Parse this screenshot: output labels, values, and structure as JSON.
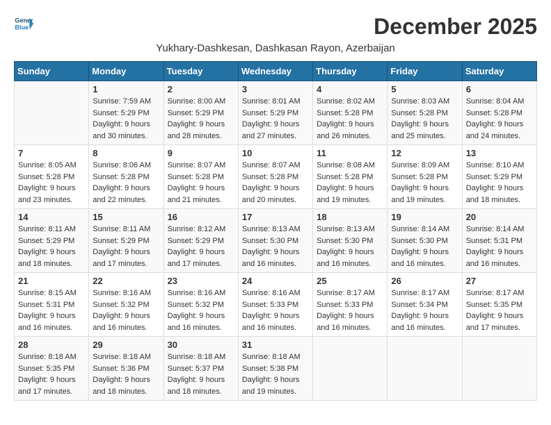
{
  "header": {
    "logo_general": "General",
    "logo_blue": "Blue",
    "month_year": "December 2025",
    "location": "Yukhary-Dashkesan, Dashkasan Rayon, Azerbaijan"
  },
  "days_of_week": [
    "Sunday",
    "Monday",
    "Tuesday",
    "Wednesday",
    "Thursday",
    "Friday",
    "Saturday"
  ],
  "weeks": [
    [
      {
        "day": "",
        "info": ""
      },
      {
        "day": "1",
        "info": "Sunrise: 7:59 AM\nSunset: 5:29 PM\nDaylight: 9 hours and 30 minutes."
      },
      {
        "day": "2",
        "info": "Sunrise: 8:00 AM\nSunset: 5:29 PM\nDaylight: 9 hours and 28 minutes."
      },
      {
        "day": "3",
        "info": "Sunrise: 8:01 AM\nSunset: 5:29 PM\nDaylight: 9 hours and 27 minutes."
      },
      {
        "day": "4",
        "info": "Sunrise: 8:02 AM\nSunset: 5:28 PM\nDaylight: 9 hours and 26 minutes."
      },
      {
        "day": "5",
        "info": "Sunrise: 8:03 AM\nSunset: 5:28 PM\nDaylight: 9 hours and 25 minutes."
      },
      {
        "day": "6",
        "info": "Sunrise: 8:04 AM\nSunset: 5:28 PM\nDaylight: 9 hours and 24 minutes."
      }
    ],
    [
      {
        "day": "7",
        "info": "Sunrise: 8:05 AM\nSunset: 5:28 PM\nDaylight: 9 hours and 23 minutes."
      },
      {
        "day": "8",
        "info": "Sunrise: 8:06 AM\nSunset: 5:28 PM\nDaylight: 9 hours and 22 minutes."
      },
      {
        "day": "9",
        "info": "Sunrise: 8:07 AM\nSunset: 5:28 PM\nDaylight: 9 hours and 21 minutes."
      },
      {
        "day": "10",
        "info": "Sunrise: 8:07 AM\nSunset: 5:28 PM\nDaylight: 9 hours and 20 minutes."
      },
      {
        "day": "11",
        "info": "Sunrise: 8:08 AM\nSunset: 5:28 PM\nDaylight: 9 hours and 19 minutes."
      },
      {
        "day": "12",
        "info": "Sunrise: 8:09 AM\nSunset: 5:28 PM\nDaylight: 9 hours and 19 minutes."
      },
      {
        "day": "13",
        "info": "Sunrise: 8:10 AM\nSunset: 5:29 PM\nDaylight: 9 hours and 18 minutes."
      }
    ],
    [
      {
        "day": "14",
        "info": "Sunrise: 8:11 AM\nSunset: 5:29 PM\nDaylight: 9 hours and 18 minutes."
      },
      {
        "day": "15",
        "info": "Sunrise: 8:11 AM\nSunset: 5:29 PM\nDaylight: 9 hours and 17 minutes."
      },
      {
        "day": "16",
        "info": "Sunrise: 8:12 AM\nSunset: 5:29 PM\nDaylight: 9 hours and 17 minutes."
      },
      {
        "day": "17",
        "info": "Sunrise: 8:13 AM\nSunset: 5:30 PM\nDaylight: 9 hours and 16 minutes."
      },
      {
        "day": "18",
        "info": "Sunrise: 8:13 AM\nSunset: 5:30 PM\nDaylight: 9 hours and 16 minutes."
      },
      {
        "day": "19",
        "info": "Sunrise: 8:14 AM\nSunset: 5:30 PM\nDaylight: 9 hours and 16 minutes."
      },
      {
        "day": "20",
        "info": "Sunrise: 8:14 AM\nSunset: 5:31 PM\nDaylight: 9 hours and 16 minutes."
      }
    ],
    [
      {
        "day": "21",
        "info": "Sunrise: 8:15 AM\nSunset: 5:31 PM\nDaylight: 9 hours and 16 minutes."
      },
      {
        "day": "22",
        "info": "Sunrise: 8:16 AM\nSunset: 5:32 PM\nDaylight: 9 hours and 16 minutes."
      },
      {
        "day": "23",
        "info": "Sunrise: 8:16 AM\nSunset: 5:32 PM\nDaylight: 9 hours and 16 minutes."
      },
      {
        "day": "24",
        "info": "Sunrise: 8:16 AM\nSunset: 5:33 PM\nDaylight: 9 hours and 16 minutes."
      },
      {
        "day": "25",
        "info": "Sunrise: 8:17 AM\nSunset: 5:33 PM\nDaylight: 9 hours and 16 minutes."
      },
      {
        "day": "26",
        "info": "Sunrise: 8:17 AM\nSunset: 5:34 PM\nDaylight: 9 hours and 16 minutes."
      },
      {
        "day": "27",
        "info": "Sunrise: 8:17 AM\nSunset: 5:35 PM\nDaylight: 9 hours and 17 minutes."
      }
    ],
    [
      {
        "day": "28",
        "info": "Sunrise: 8:18 AM\nSunset: 5:35 PM\nDaylight: 9 hours and 17 minutes."
      },
      {
        "day": "29",
        "info": "Sunrise: 8:18 AM\nSunset: 5:36 PM\nDaylight: 9 hours and 18 minutes."
      },
      {
        "day": "30",
        "info": "Sunrise: 8:18 AM\nSunset: 5:37 PM\nDaylight: 9 hours and 18 minutes."
      },
      {
        "day": "31",
        "info": "Sunrise: 8:18 AM\nSunset: 5:38 PM\nDaylight: 9 hours and 19 minutes."
      },
      {
        "day": "",
        "info": ""
      },
      {
        "day": "",
        "info": ""
      },
      {
        "day": "",
        "info": ""
      }
    ]
  ]
}
